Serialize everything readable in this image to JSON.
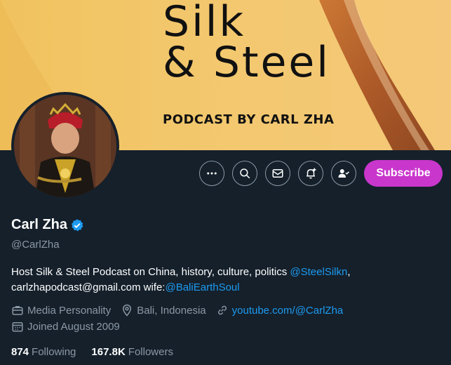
{
  "banner": {
    "title_line1": "Silk",
    "title_line2": "& Steel",
    "subtitle": "PODCAST BY CARL ZHA"
  },
  "actions": {
    "more_icon": "more-icon",
    "search_icon": "search-icon",
    "message_icon": "envelope-icon",
    "notify_icon": "bell-plus-icon",
    "following_icon": "person-check-icon",
    "subscribe_label": "Subscribe"
  },
  "profile": {
    "name": "Carl Zha",
    "handle": "@CarlZha",
    "verified": true,
    "bio_text_1": "Host Silk & Steel Podcast on China, history, culture, politics ",
    "bio_mention_1": "@SteelSilkn",
    "bio_text_2": ",",
    "bio_text_3": "carlzhapodcast@gmail.com wife:",
    "bio_mention_2": "@BaliEarthSoul",
    "category": "Media Personality",
    "location": "Bali, Indonesia",
    "website": "youtube.com/@CarlZha",
    "joined": "Joined August 2009",
    "following_count": "874",
    "following_label": "Following",
    "followers_count": "167.8K",
    "followers_label": "Followers"
  },
  "colors": {
    "background": "#15202b",
    "accent_link": "#1d9bf0",
    "subscribe": "#c936cc",
    "muted": "#8b98a5",
    "banner": "#f3c870"
  }
}
